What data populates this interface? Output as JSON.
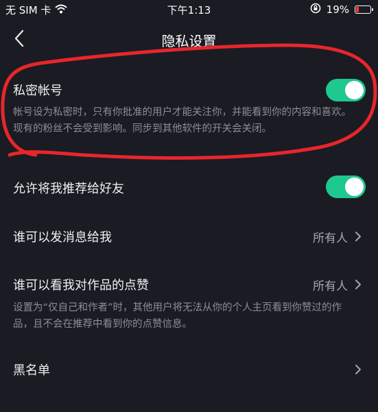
{
  "status_bar": {
    "carrier": "无 SIM 卡",
    "time": "下午1:13",
    "battery_percent": "19%",
    "battery_level": 0.19,
    "icons": [
      "wifi-icon",
      "rotation-lock-icon",
      "battery-icon"
    ]
  },
  "nav": {
    "title": "隐私设置",
    "back_icon": "back-chevron-icon"
  },
  "settings": {
    "private_account": {
      "title": "私密帐号",
      "description": "帐号设为私密时，只有你批准的用户才能关注你，并能看到你的内容和喜欢。现有的粉丝不会受到影响。同步到其他软件的开关会关闭。",
      "enabled": true
    },
    "recommend_to_friends": {
      "title": "允许将我推荐给好友",
      "enabled": true
    },
    "who_can_message": {
      "title": "谁可以发消息给我",
      "value": "所有人"
    },
    "who_can_see_likes": {
      "title": "谁可以看我对作品的点赞",
      "value": "所有人",
      "description": "设置为“仅自己和作者”时，其他用户将无法从你的个人主页看到你赞过的作品，且不会在推荐中看到你的点赞信息。"
    },
    "blacklist": {
      "title": "黑名单"
    }
  },
  "colors": {
    "background": "#1a1b23",
    "toggle_on": "#1fc88f",
    "annotation": "#e8262a",
    "secondary_text": "#8d8e96"
  }
}
